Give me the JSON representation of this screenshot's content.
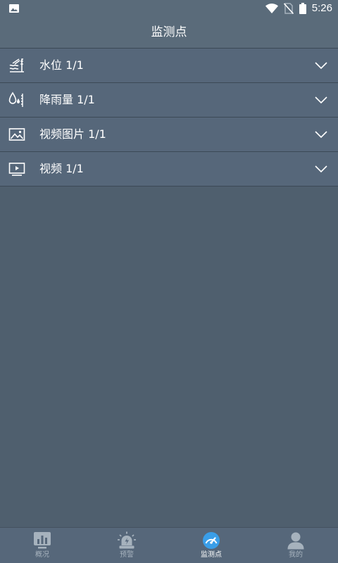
{
  "status_bar": {
    "time": "5:26",
    "icons": [
      "image-notification-icon",
      "wifi-icon",
      "no-sim-icon",
      "battery-icon"
    ]
  },
  "header": {
    "title": "监测点"
  },
  "list": {
    "items": [
      {
        "icon": "water-level-icon",
        "label": "水位 1/1"
      },
      {
        "icon": "rainfall-icon",
        "label": "降雨量 1/1"
      },
      {
        "icon": "image-icon",
        "label": "视频图片 1/1"
      },
      {
        "icon": "video-icon",
        "label": "视频 1/1"
      }
    ]
  },
  "tab_bar": {
    "tabs": [
      {
        "icon": "overview-chart-icon",
        "label": "概况",
        "active": false
      },
      {
        "icon": "alarm-siren-icon",
        "label": "预警",
        "active": false
      },
      {
        "icon": "gauge-icon",
        "label": "监测点",
        "active": true
      },
      {
        "icon": "user-icon",
        "label": "我的",
        "active": false
      }
    ]
  },
  "colors": {
    "background": "#4f5f6e",
    "bar": "#5a6b7a",
    "active_accent": "#3a9ee8"
  }
}
